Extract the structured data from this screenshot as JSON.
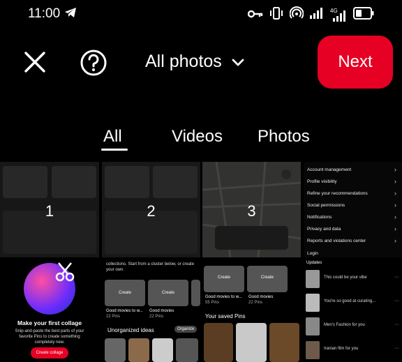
{
  "status_bar": {
    "time": "11:00",
    "network": "4G",
    "icons": [
      "telegram-icon",
      "key-icon",
      "vibrate-icon",
      "hotspot-icon",
      "signal-icon",
      "battery-icon"
    ]
  },
  "top_bar": {
    "album_label": "All photos",
    "next_label": "Next"
  },
  "tabs": [
    {
      "label": "All",
      "selected": true
    },
    {
      "label": "Videos",
      "selected": false
    },
    {
      "label": "Photos",
      "selected": false
    }
  ],
  "grid": {
    "selected_numbers": [
      "1",
      "2",
      "3"
    ],
    "settings_menu": [
      "Account management",
      "Profile visibility",
      "Refine your recommendations",
      "Social permissions",
      "Notifications",
      "Privacy and data",
      "Reports and violations center",
      "Login"
    ],
    "collage": {
      "title": "Make your first collage",
      "description": "Snip-and-paste the best parts of your favorite Pins to create something completely new.",
      "button": "Create collage"
    },
    "board_cell": {
      "intro": "collections. Start from a cluster below, or create your own.",
      "create_label": "Create",
      "board1_title": "Good movies to w...",
      "board1_count": "22 Pins",
      "board2_title": "Good movies",
      "board2_count": "22 Pins",
      "unorganized": "Unorganized ideas",
      "organize": "Organize"
    },
    "pins_cell": {
      "create_label": "Create",
      "board1_title": "Good movies to w...",
      "board1_count": "55 Pins",
      "board2_title": "Good movies",
      "board2_count": "22 Pins",
      "saved_pins": "Your saved Pins"
    },
    "updates_cell": {
      "heading": "Updates",
      "items": [
        "This could be your vibe",
        "You're so good at curating...",
        "Men's Fashion for you",
        "Iranian film for you"
      ]
    }
  },
  "colors": {
    "accent": "#e60023",
    "background": "#000000",
    "text": "#ffffff"
  }
}
